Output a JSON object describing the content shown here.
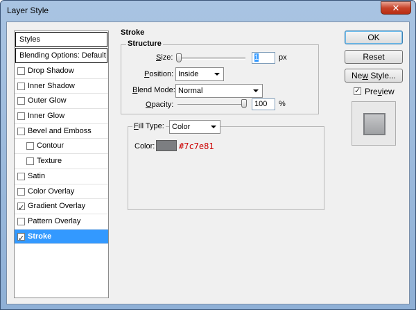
{
  "window": {
    "title": "Layer Style",
    "close_glyph": "✕"
  },
  "styles_panel": {
    "header": "Styles",
    "blending_options": "Blending Options: Default",
    "items": [
      {
        "label": "Drop Shadow",
        "checked": false,
        "sub": false,
        "selected": false
      },
      {
        "label": "Inner Shadow",
        "checked": false,
        "sub": false,
        "selected": false
      },
      {
        "label": "Outer Glow",
        "checked": false,
        "sub": false,
        "selected": false
      },
      {
        "label": "Inner Glow",
        "checked": false,
        "sub": false,
        "selected": false
      },
      {
        "label": "Bevel and Emboss",
        "checked": false,
        "sub": false,
        "selected": false
      },
      {
        "label": "Contour",
        "checked": false,
        "sub": true,
        "selected": false
      },
      {
        "label": "Texture",
        "checked": false,
        "sub": true,
        "selected": false
      },
      {
        "label": "Satin",
        "checked": false,
        "sub": false,
        "selected": false
      },
      {
        "label": "Color Overlay",
        "checked": false,
        "sub": false,
        "selected": false
      },
      {
        "label": "Gradient Overlay",
        "checked": true,
        "sub": false,
        "selected": false
      },
      {
        "label": "Pattern Overlay",
        "checked": false,
        "sub": false,
        "selected": false
      },
      {
        "label": "Stroke",
        "checked": true,
        "sub": false,
        "selected": true
      }
    ]
  },
  "stroke": {
    "title": "Stroke",
    "structure": {
      "legend": "Structure",
      "size_label_u": "S",
      "size_label_rest": "ize:",
      "size_value": "1",
      "size_unit": "px",
      "size_fraction": 0.0,
      "position_label_u": "P",
      "position_label_rest": "osition:",
      "position_value": "Inside",
      "blend_label_pre": "",
      "blend_label_u": "B",
      "blend_label_rest": "lend Mode:",
      "blend_value": "Normal",
      "opacity_label_u": "O",
      "opacity_label_rest": "pacity:",
      "opacity_value": "100",
      "opacity_unit": "%",
      "opacity_fraction": 1.0
    },
    "fill": {
      "legend_u": "F",
      "legend_rest": "ill Type:",
      "fill_type_value": "Color",
      "color_label": "Color:",
      "color_hex": "#7c7e81",
      "color_swatch": "#7c7e81",
      "hex_text_color": "#cc0000"
    }
  },
  "buttons": {
    "ok": "OK",
    "reset": "Reset",
    "new_style_u": "w",
    "new_style_pre": "Ne",
    "new_style_rest": " Style...",
    "preview_label_u": "v",
    "preview_label_pre": "Pre",
    "preview_label_rest": "iew",
    "preview_checked": true
  }
}
